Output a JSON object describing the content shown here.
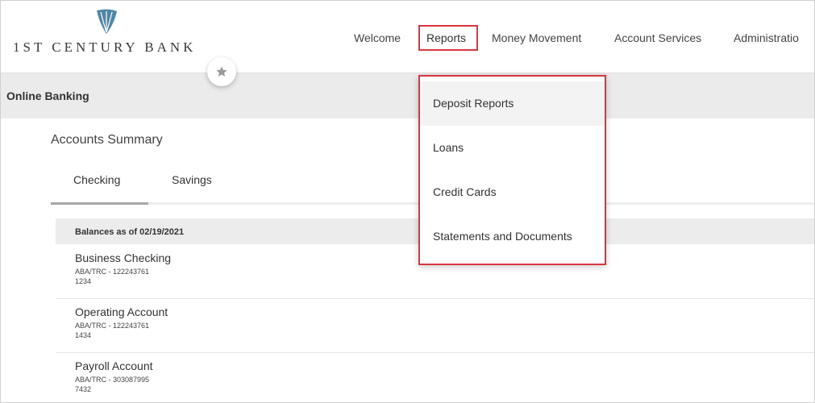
{
  "brand": {
    "name": "1ST CENTURY BANK",
    "logo_icon": "shell-logo-icon",
    "accent_color": "#4f87a6"
  },
  "header": {
    "favorite_icon": "star-icon",
    "nav": {
      "items": [
        {
          "label": "Welcome"
        },
        {
          "label": "Reports"
        },
        {
          "label": "Money Movement"
        },
        {
          "label": "Account Services"
        },
        {
          "label": "Administratio"
        }
      ]
    }
  },
  "reports_menu": {
    "items": [
      {
        "label": "Deposit Reports"
      },
      {
        "label": "Loans"
      },
      {
        "label": "Credit Cards"
      },
      {
        "label": "Statements and Documents"
      }
    ],
    "highlight_color": "#d9363e"
  },
  "section": {
    "title": "Online Banking"
  },
  "summary": {
    "title": "Accounts Summary",
    "tabs": [
      {
        "label": "Checking"
      },
      {
        "label": "Savings"
      }
    ],
    "balances_header": "Balances as of 02/19/2021",
    "accounts": [
      {
        "name": "Business Checking",
        "aba": "ABA/TRC - 122243761",
        "number": "1234"
      },
      {
        "name": "Operating Account",
        "aba": "ABA/TRC - 122243761",
        "number": "1434"
      },
      {
        "name": "Payroll Account",
        "aba": "ABA/TRC - 303087995",
        "number": "7432"
      }
    ]
  }
}
